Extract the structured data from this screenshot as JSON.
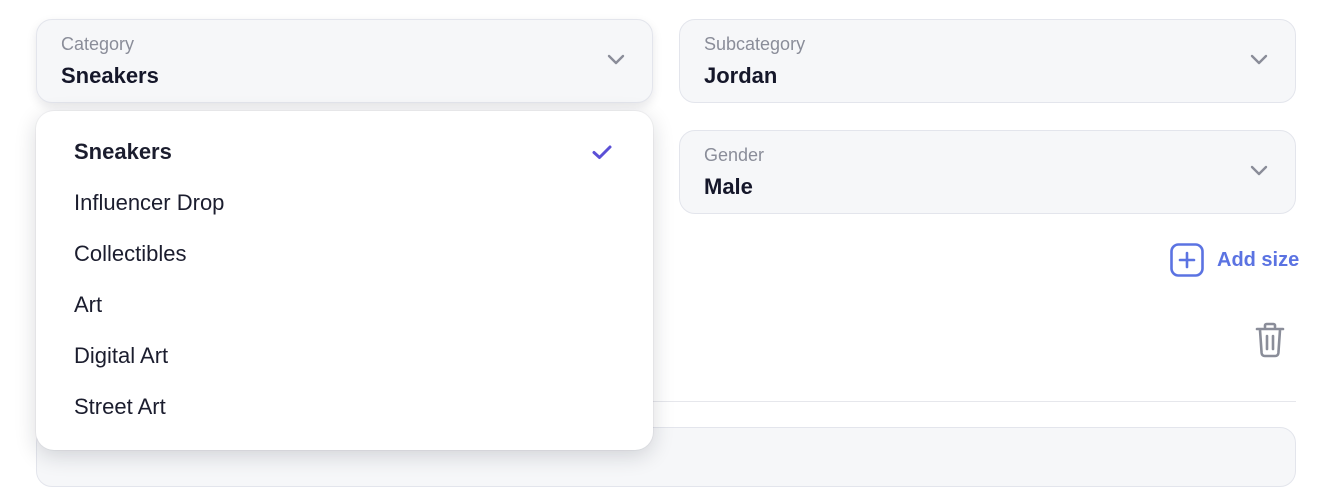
{
  "category": {
    "label": "Category",
    "value": "Sneakers",
    "options": [
      "Sneakers",
      "Influencer Drop",
      "Collectibles",
      "Art",
      "Digital Art",
      "Street Art"
    ],
    "selected_index": 0
  },
  "subcategory": {
    "label": "Subcategory",
    "value": "Jordan"
  },
  "gender": {
    "label": "Gender",
    "value": "Male"
  },
  "sizes": {
    "add_label": "Add size"
  },
  "icons": {
    "chevron": "chevron-down-icon",
    "plus": "plus-square-icon",
    "trash": "trash-icon",
    "check": "check-icon"
  },
  "colors": {
    "accent": "#5b73e2",
    "check": "#5b50d6",
    "field_bg": "#f6f7f9"
  }
}
